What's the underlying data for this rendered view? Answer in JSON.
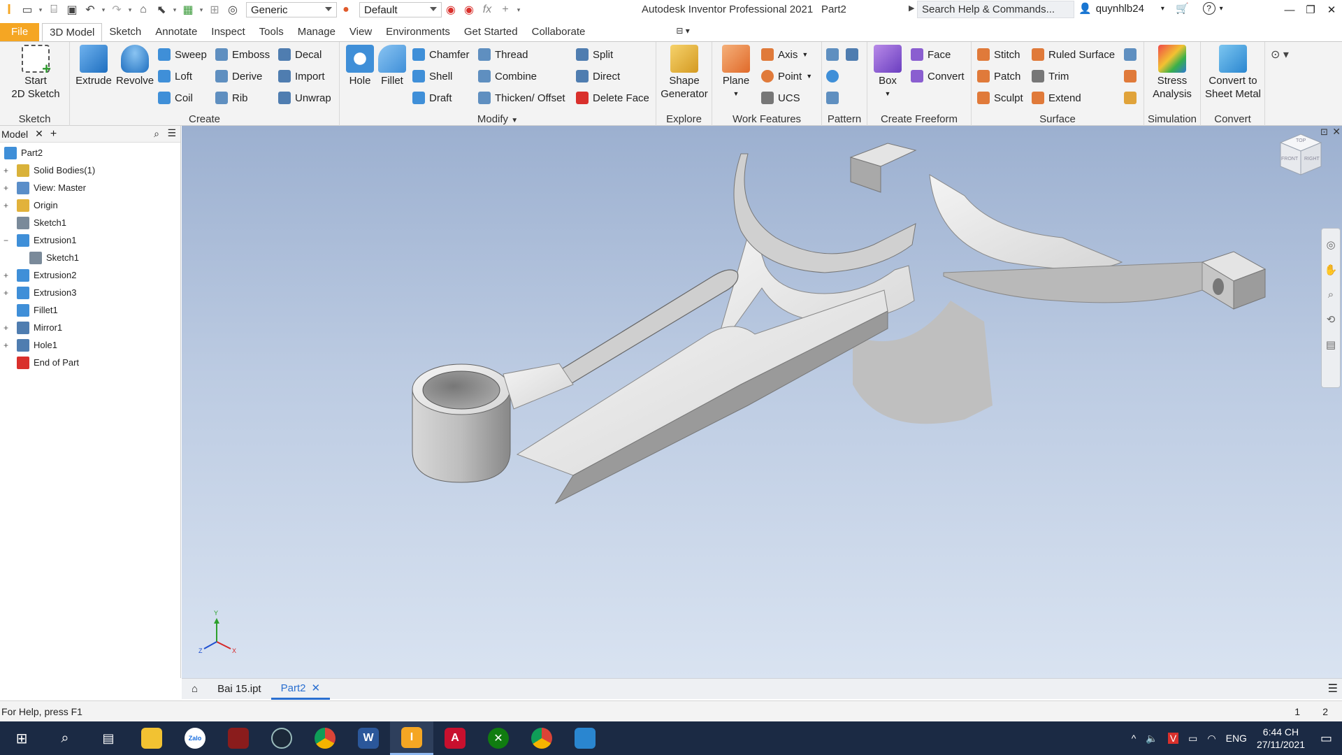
{
  "titlebar": {
    "app_title": "Autodesk Inventor Professional 2021",
    "doc_name": "Part2",
    "appearance_select": "Generic",
    "material_select": "Default",
    "search_placeholder": "Search Help & Commands...",
    "username": "quynhlb24"
  },
  "tabs": {
    "file": "File",
    "items": [
      "3D Model",
      "Sketch",
      "Annotate",
      "Inspect",
      "Tools",
      "Manage",
      "View",
      "Environments",
      "Get Started",
      "Collaborate"
    ]
  },
  "ribbon": {
    "sketch": {
      "start_label_1": "Start",
      "start_label_2": "2D Sketch",
      "panel": "Sketch"
    },
    "create": {
      "extrude": "Extrude",
      "revolve": "Revolve",
      "sweep": "Sweep",
      "emboss": "Emboss",
      "decal": "Decal",
      "loft": "Loft",
      "derive": "Derive",
      "import": "Import",
      "coil": "Coil",
      "rib": "Rib",
      "unwrap": "Unwrap",
      "panel": "Create"
    },
    "modify": {
      "hole": "Hole",
      "fillet": "Fillet",
      "chamfer": "Chamfer",
      "thread": "Thread",
      "split": "Split",
      "shell": "Shell",
      "combine": "Combine",
      "direct": "Direct",
      "draft": "Draft",
      "thicken": "Thicken/ Offset",
      "delete_face": "Delete Face",
      "panel": "Modify"
    },
    "explore": {
      "shape_1": "Shape",
      "shape_2": "Generator",
      "panel": "Explore"
    },
    "work": {
      "plane": "Plane",
      "axis": "Axis",
      "point": "Point",
      "ucs": "UCS",
      "panel": "Work Features"
    },
    "pattern": {
      "panel": "Pattern"
    },
    "freeform": {
      "box": "Box",
      "face": "Face",
      "convert": "Convert",
      "panel": "Create Freeform"
    },
    "surface": {
      "stitch": "Stitch",
      "ruled": "Ruled Surface",
      "patch": "Patch",
      "trim": "Trim",
      "sculpt": "Sculpt",
      "extend": "Extend",
      "panel": "Surface"
    },
    "simulation": {
      "stress_1": "Stress",
      "stress_2": "Analysis",
      "panel": "Simulation"
    },
    "convert": {
      "sheet_1": "Convert to",
      "sheet_2": "Sheet Metal",
      "panel": "Convert"
    }
  },
  "browser": {
    "tab": "Model",
    "tree": [
      {
        "label": "Part2",
        "color": "#3f8fd8"
      },
      {
        "label": "Solid Bodies(1)",
        "color": "#d9b23a"
      },
      {
        "label": "View: Master",
        "color": "#5a8ec9"
      },
      {
        "label": "Origin",
        "color": "#e2b23b"
      },
      {
        "label": "Sketch1",
        "color": "#7a8a9a"
      },
      {
        "label": "Extrusion1",
        "color": "#3f8fd8"
      },
      {
        "label": "Sketch1",
        "color": "#7a8a9a"
      },
      {
        "label": "Extrusion2",
        "color": "#3f8fd8"
      },
      {
        "label": "Extrusion3",
        "color": "#3f8fd8"
      },
      {
        "label": "Fillet1",
        "color": "#3f8fd8"
      },
      {
        "label": "Mirror1",
        "color": "#4f7db0"
      },
      {
        "label": "Hole1",
        "color": "#4f7db0"
      },
      {
        "label": "End of Part",
        "color": "#d9302c"
      }
    ]
  },
  "viewcube": {
    "top": "TOP",
    "front": "FRONT",
    "right": "RIGHT"
  },
  "triad": {
    "x": "X",
    "y": "Y",
    "z": "Z"
  },
  "doctabs": {
    "tab1": "Bai 15.ipt",
    "tab2": "Part2"
  },
  "status": {
    "help": "For Help, press F1",
    "count1": "1",
    "count2": "2"
  },
  "taskbar": {
    "lang": "ENG",
    "time": "6:44 CH",
    "date": "27/11/2021",
    "zalo": "Zalo"
  }
}
